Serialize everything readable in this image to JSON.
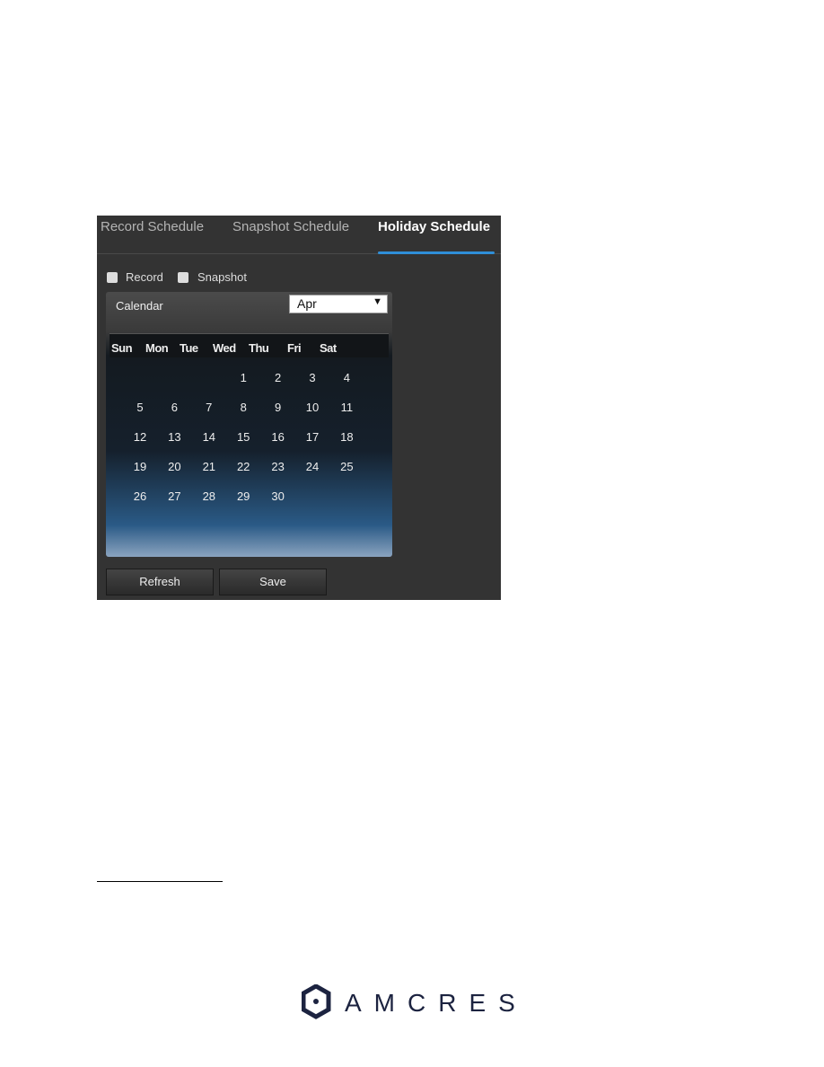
{
  "tabs": [
    {
      "label": "Record Schedule",
      "active": false
    },
    {
      "label": "Snapshot Schedule",
      "active": false
    },
    {
      "label": "Holiday Schedule",
      "active": true
    }
  ],
  "checkboxes": [
    {
      "label": "Record",
      "checked": false
    },
    {
      "label": "Snapshot",
      "checked": false
    }
  ],
  "calendar": {
    "title": "Calendar",
    "month": "Apr",
    "day_names": [
      "Sun",
      "Mon",
      "Tue",
      "Wed",
      "Thu",
      "Fri",
      "Sat"
    ],
    "weeks": [
      [
        null,
        null,
        null,
        "1",
        "2",
        "3",
        "4"
      ],
      [
        "5",
        "6",
        "7",
        "8",
        "9",
        "10",
        "11"
      ],
      [
        "12",
        "13",
        "14",
        "15",
        "16",
        "17",
        "18"
      ],
      [
        "19",
        "20",
        "21",
        "22",
        "23",
        "24",
        "25"
      ],
      [
        "26",
        "27",
        "28",
        "29",
        "30",
        null,
        null
      ]
    ]
  },
  "buttons": {
    "refresh": "Refresh",
    "save": "Save"
  },
  "logo": {
    "text": "AMCREST",
    "color": "#1c2340"
  },
  "colors": {
    "accent": "#2f8fd8",
    "panel": "#333333"
  }
}
